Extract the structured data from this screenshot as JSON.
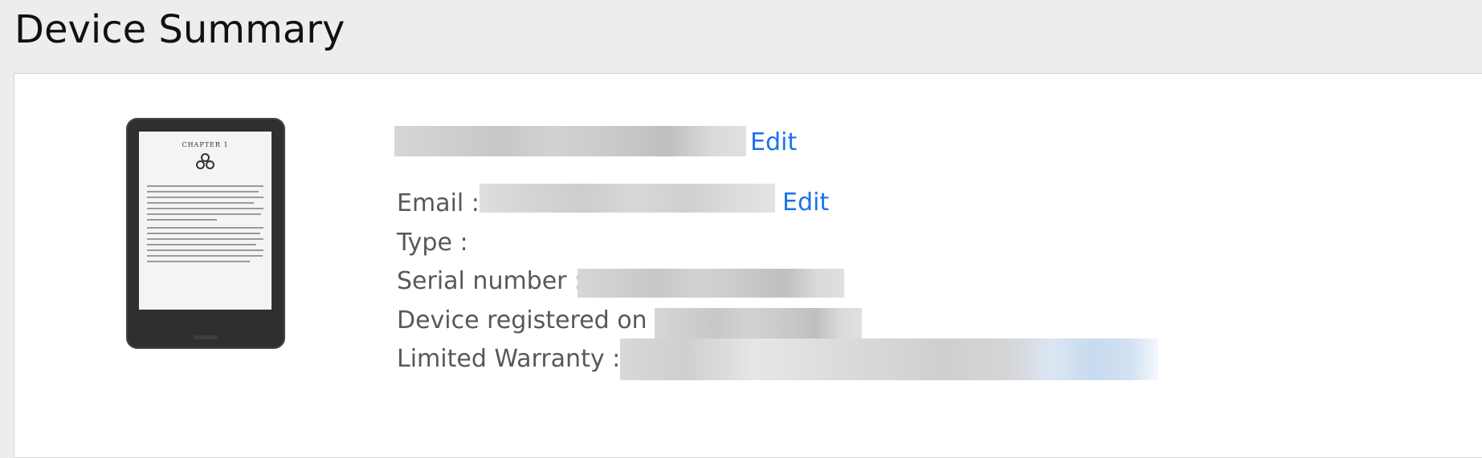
{
  "page": {
    "title": "Device Summary"
  },
  "device": {
    "image_icon": "kindle-device-image",
    "screen_chapter": "CHAPTER 1",
    "name_edit_label": "Edit",
    "email_edit_label": "Edit"
  },
  "fields": {
    "email_label": "Email :",
    "type_label": "Type :",
    "serial_label": "Serial number :",
    "registered_label": "Device registered on :",
    "warranty_label": "Limited Warranty :"
  },
  "colors": {
    "link": "#1a73e8",
    "label": "#565959",
    "page_bg": "#eceeee",
    "card_bg": "#ffffff"
  }
}
